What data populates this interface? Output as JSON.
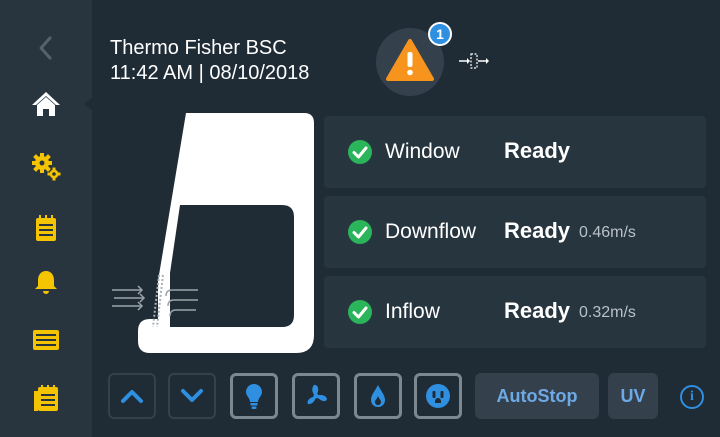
{
  "header": {
    "device_name": "Thermo Fisher BSC",
    "datetime": "11:42  AM | 08/10/2018",
    "alert_count": "1"
  },
  "sidebar": {
    "items": [
      {
        "icon": "back-chevron-icon"
      },
      {
        "icon": "home-icon",
        "active": true
      },
      {
        "icon": "settings-gears-icon"
      },
      {
        "icon": "clipboard-icon"
      },
      {
        "icon": "bell-icon"
      },
      {
        "icon": "display-icon"
      },
      {
        "icon": "calendar-icon"
      }
    ]
  },
  "status": [
    {
      "name": "Window",
      "state": "Ready",
      "value": ""
    },
    {
      "name": "Downflow",
      "state": "Ready",
      "value": "0.46m/s"
    },
    {
      "name": "Inflow",
      "state": "Ready",
      "value": "0.32m/s"
    }
  ],
  "toolbar": {
    "autostop_label": "AutoStop",
    "uv_label": "UV",
    "info_label": "i"
  },
  "colors": {
    "background": "#1f2c36",
    "sidebar": "#28353f",
    "accent_blue": "#2f8fe0",
    "warning_orange": "#f7941d",
    "ready_green": "#2bb55a",
    "icon_yellow": "#f5c400"
  }
}
